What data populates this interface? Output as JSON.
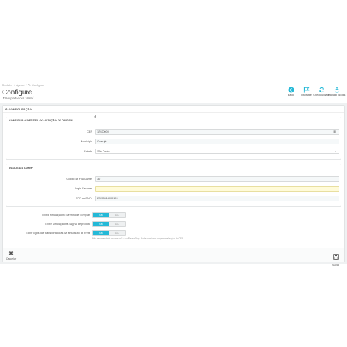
{
  "breadcrumb": [
    "Modules",
    "rigenet",
    "Configure"
  ],
  "page": {
    "title": "Configure",
    "subtitle": "Transportadora Jamef"
  },
  "toolbar": [
    {
      "label": "Back",
      "icon": "back-icon"
    },
    {
      "label": "Translate",
      "icon": "flag-icon"
    },
    {
      "label": "Check update",
      "icon": "refresh-icon"
    },
    {
      "label": "Manage hooks",
      "icon": "anchor-icon"
    }
  ],
  "panel": {
    "title": "CONFIGURAÇÃO"
  },
  "origin": {
    "title": "CONFIGURAÇÕES DE LOCALIZAÇÃO DE ORIGEM",
    "cep": {
      "label": "CEP",
      "value": "17020000"
    },
    "municipio": {
      "label": "Município",
      "value": "Guarujá"
    },
    "estado": {
      "label": "Estado",
      "value": "São Paulo"
    }
  },
  "jamef": {
    "title": "DADOS DA JAMEF",
    "filial": {
      "label": "Código da Filial Jamef",
      "value": "30"
    },
    "login": {
      "label": "Login Escamef",
      "value": ""
    },
    "cpf": {
      "label": "CPF ou CNPJ",
      "value": "22255314000199"
    }
  },
  "switches": [
    {
      "label": "Exibir simulação no carrinho de compras",
      "on": "SIM",
      "off": "NÃO"
    },
    {
      "label": "Exibir simulação na página de produto",
      "on": "SIM",
      "off": "NÃO"
    },
    {
      "label": "Exibir logos das transportadoras na simulação de Frete",
      "on": "SIM",
      "off": "NÃO"
    }
  ],
  "help_text": "Não recomendado na versão 1.6 do PrestaShop. Pode ocasionar na personalização do CSS",
  "footer": {
    "cancel": "Cancelar",
    "save": "Salvar"
  },
  "colors": {
    "accent": "#25b9d7",
    "highlight_field": "#fffbd9"
  }
}
